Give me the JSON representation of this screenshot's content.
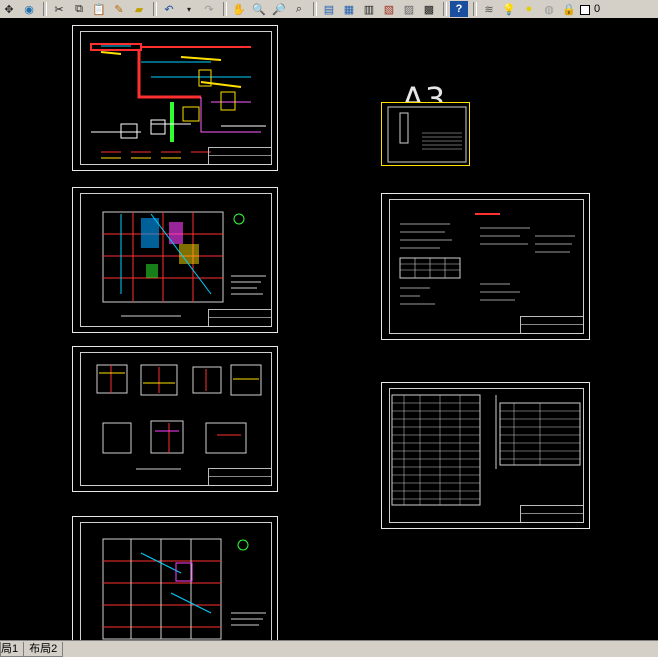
{
  "toolbar": {
    "buttons": [
      "pan-icon",
      "globe-icon",
      "cut-icon",
      "copy-icon",
      "paste-icon",
      "brush-icon",
      "eraser-icon",
      "undo-icon",
      "dropdown-icon",
      "redo-icon",
      "pan-hand-icon",
      "zoom-realtime-icon",
      "zoom-window-icon",
      "zoom-previous-icon",
      "properties-icon",
      "design-center-icon",
      "tool-palette-icon",
      "sheet-set-icon",
      "markup-icon",
      "calculator-icon",
      "help-icon",
      "layers-icon",
      "bulb-icon",
      "sun-icon",
      "freeze-icon",
      "lock-icon",
      "color-square-icon"
    ],
    "layer_value": "0"
  },
  "drawing": {
    "label_a3": "A3"
  },
  "tabs": {
    "layout1": "局1",
    "layout2": "布局2"
  }
}
